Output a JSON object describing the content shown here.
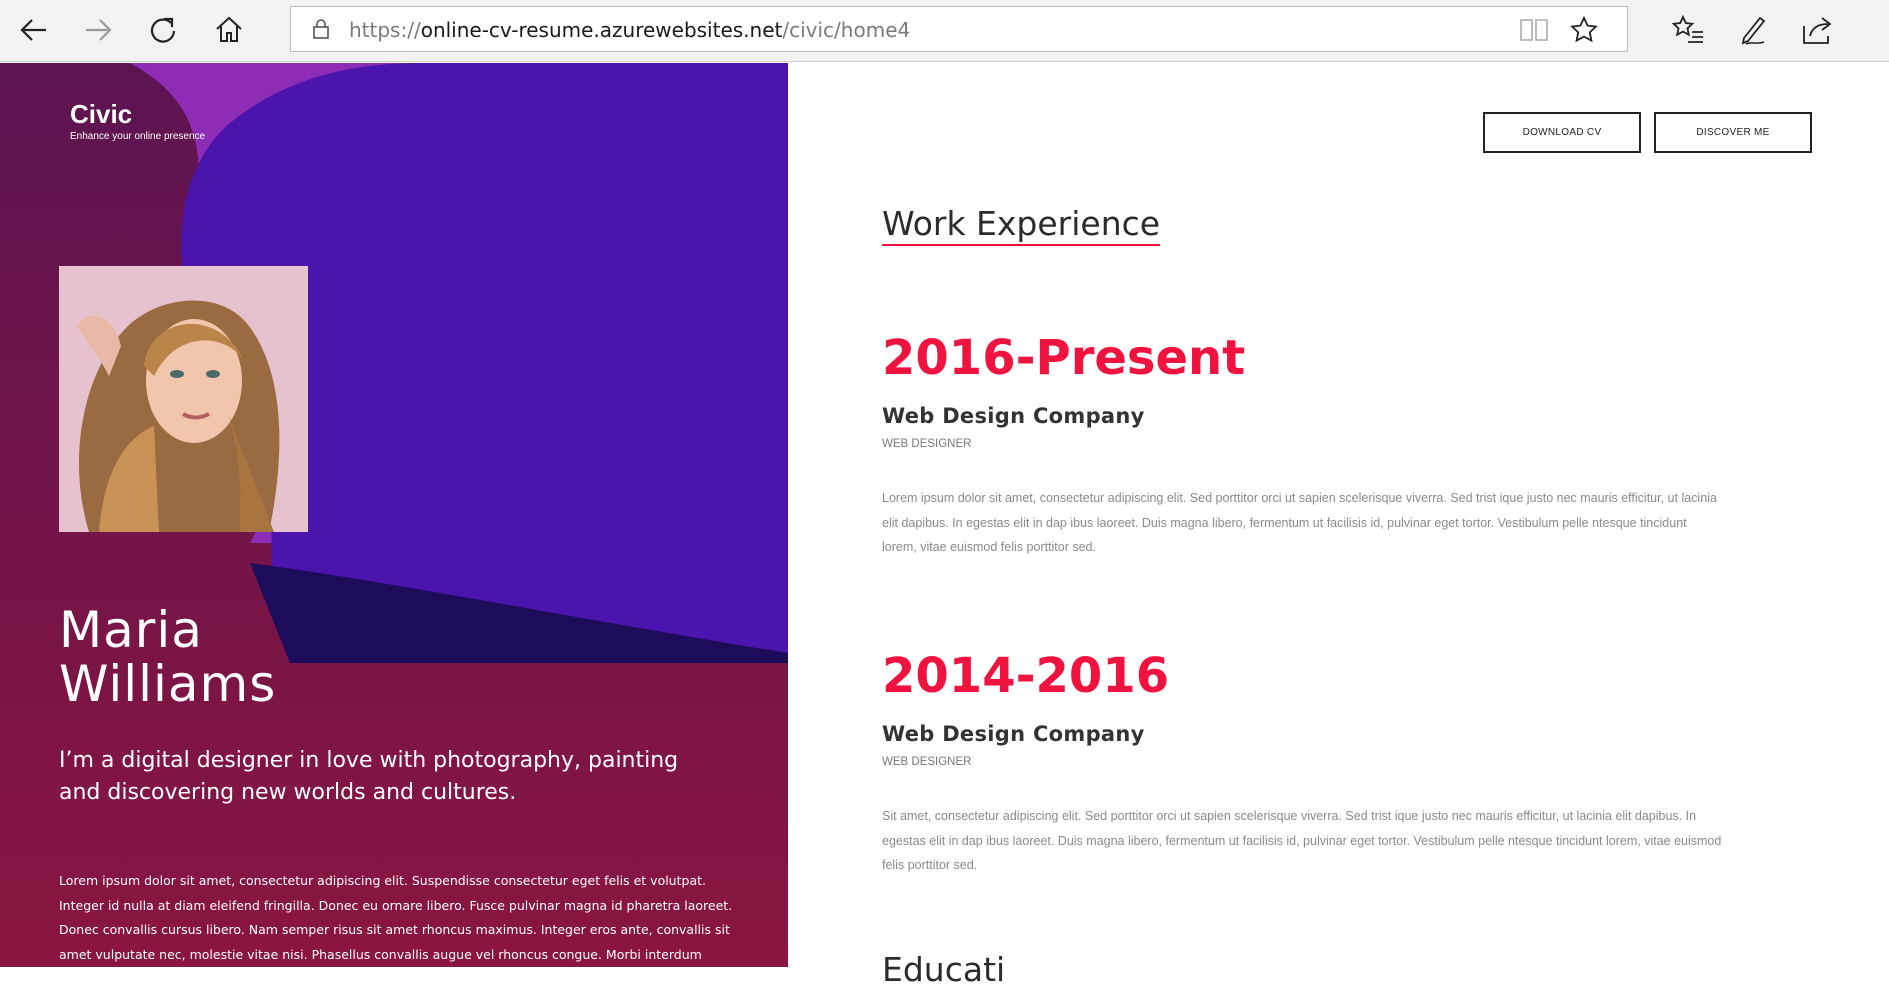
{
  "browser": {
    "url_prefix": "https://",
    "url_host": "online-cv-resume.azurewebsites.net",
    "url_path": "/civic/home4",
    "icons": [
      "back-icon",
      "forward-icon",
      "refresh-icon",
      "home-icon",
      "lock-icon",
      "reading-view-icon",
      "favorite-star-icon",
      "favorites-list-icon",
      "pen-icon",
      "share-icon"
    ]
  },
  "sidebar": {
    "brand": "Civic",
    "tagline": "Enhance your online presence",
    "name_line1": "Maria",
    "name_line2": "Williams",
    "intro": "I’m a digital designer in love with photography, painting and discovering new worlds and cultures.",
    "bio": "Lorem ipsum dolor sit amet, consectetur adipiscing elit. Suspendisse consectetur eget felis et volutpat. Integer id nulla at diam eleifend fringilla. Donec eu ornare libero. Fusce pulvinar magna id pharetra laoreet. Donec convallis cursus libero. Nam semper risus sit amet rhoncus maximus. Integer eros ante, convallis sit amet vulputate nec, molestie vitae nisi. Phasellus convallis augue vel rhoncus congue. Morbi interdum molestie orci"
  },
  "header": {
    "download_cv": "DOWNLOAD CV",
    "discover_me": "DISCOVER ME"
  },
  "main": {
    "section_title": "Work Experience",
    "jobs": [
      {
        "years": "2016-Present",
        "company": "Web Design Company",
        "role": "WEB DESIGNER",
        "description": "Lorem ipsum dolor sit amet, consectetur adipiscing elit. Sed porttitor orci ut sapien scelerisque viverra. Sed trist ique justo nec mauris efficitur, ut lacinia elit dapibus. In egestas elit in dap ibus laoreet. Duis magna libero, fermentum ut facilisis id, pulvinar eget tortor. Vestibulum pelle ntesque tincidunt lorem, vitae euismod felis porttitor sed."
      },
      {
        "years": "2014-2016",
        "company": "Web Design Company",
        "role": "WEB DESIGNER",
        "description": "Sit amet, consectetur adipiscing elit. Sed porttitor orci ut sapien scelerisque viverra. Sed trist ique justo nec mauris efficitur, ut lacinia elit dapibus. In egestas elit in dap ibus laoreet. Duis magna libero, fermentum ut facilisis id, pulvinar eget tortor. Vestibulum pelle ntesque tincidunt lorem, vitae euismod felis porttitor sed."
      }
    ],
    "next_section_title": "Educati"
  },
  "colors": {
    "accent": "#f0133f",
    "hero_purple": "#4b14ad",
    "hero_deep": "#7b1640",
    "text_dark": "#2b2b2b"
  }
}
